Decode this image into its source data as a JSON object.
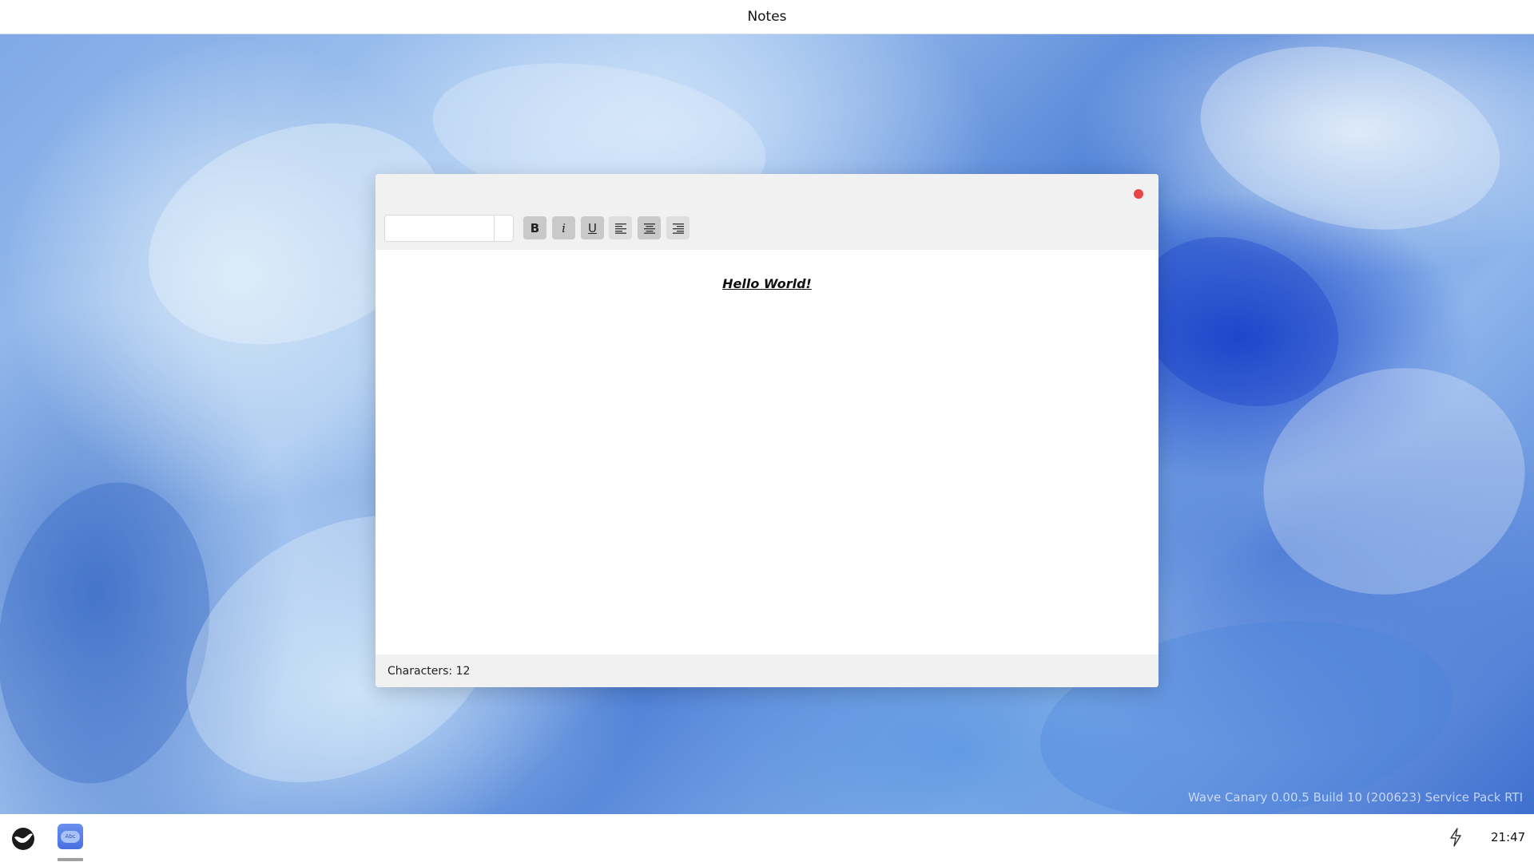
{
  "window_title": "Notes",
  "editor": {
    "font_value": "",
    "content": "Hello World!",
    "bold": true,
    "italic": true,
    "underline": true,
    "alignment": "center"
  },
  "toolbar": {
    "bold_label": "B",
    "italic_label": "i",
    "underline_label": "U"
  },
  "status": {
    "characters_text": "Characters: 12"
  },
  "desktop": {
    "version_text": "Wave Canary 0.00.5 Build 10 (200623) Service Pack RTI"
  },
  "taskbar": {
    "app_icon_text": "Abc",
    "clock": "21:47"
  },
  "colors": {
    "close_dot": "#e84545",
    "active_button": "#c9c9c9",
    "taskbar_app": "#5a80e8"
  },
  "icons": [
    "start-logo-icon",
    "notes-app-icon",
    "power-bolt-icon",
    "align-left-icon",
    "align-center-icon",
    "align-right-icon",
    "close-icon"
  ]
}
